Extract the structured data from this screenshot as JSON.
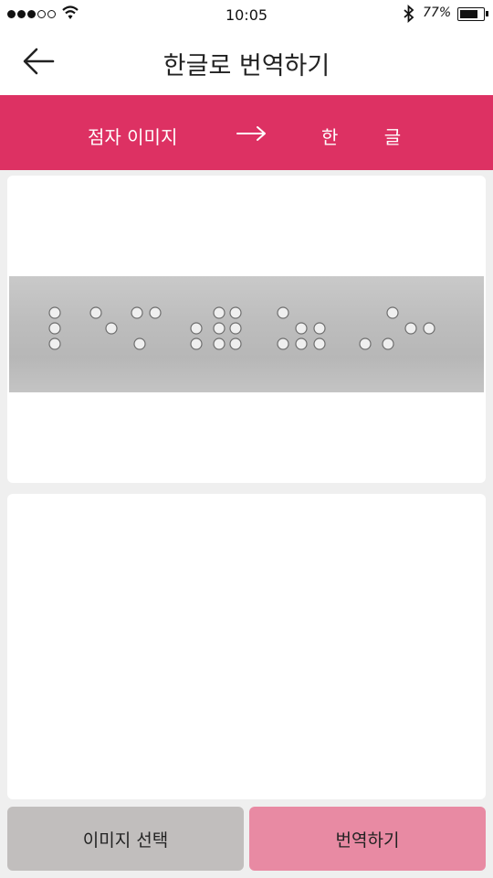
{
  "status_bar": {
    "time": "10:05",
    "battery_percent": "77%",
    "battery_level": 0.77,
    "signal_bars_filled": 3,
    "signal_bars_total": 5
  },
  "header": {
    "back_icon": "arrow-left-icon",
    "title": "한글로 번역하기"
  },
  "banner": {
    "source_label": "점자 이미지",
    "arrow_icon": "arrow-right-icon",
    "target_label": "한 글",
    "color": "#dd3163"
  },
  "image_card": {
    "content": "braille-photo"
  },
  "result_card": {
    "text": ""
  },
  "actions": {
    "select_image_label": "이미지 선택",
    "translate_label": "번역하기",
    "select_color": "#c1bebd",
    "translate_color": "#e88aa3"
  }
}
